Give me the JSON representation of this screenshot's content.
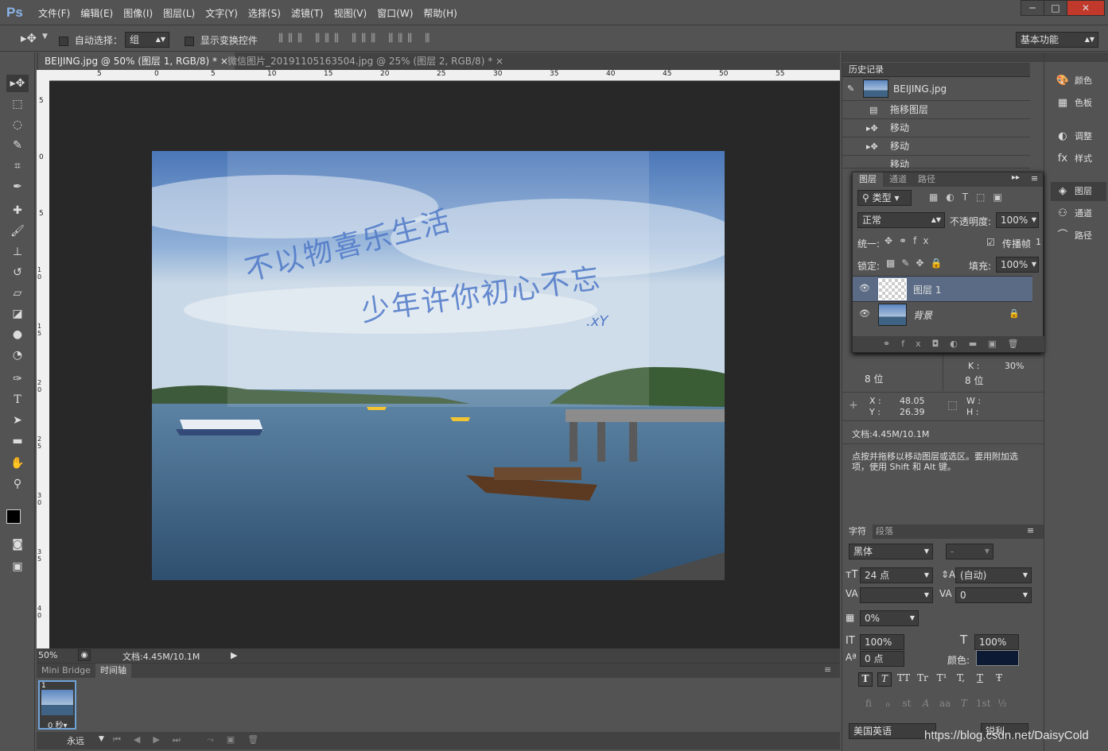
{
  "app": {
    "logo": "Ps"
  },
  "menu": [
    "文件(F)",
    "编辑(E)",
    "图像(I)",
    "图层(L)",
    "文字(Y)",
    "选择(S)",
    "滤镜(T)",
    "视图(V)",
    "窗口(W)",
    "帮助(H)"
  ],
  "window": {
    "minimize": "─",
    "restore": "□",
    "close": "✕"
  },
  "options": {
    "auto_select_label": "自动选择：",
    "auto_select_value": "组",
    "show_transform_label": "显示变换控件",
    "workspace": "基本功能"
  },
  "tabs": [
    {
      "label": "BEIJING.jpg @ 50% (图层 1, RGB/8) *",
      "close": "×"
    },
    {
      "label": "微信图片_20191105163504.jpg @ 25% (图层 2, RGB/8) *",
      "close": "×"
    }
  ],
  "ruler_top": [
    "5",
    "0",
    "5",
    "10",
    "15",
    "20",
    "25",
    "30",
    "35",
    "40",
    "45",
    "50",
    "55"
  ],
  "ruler_left": [
    "5",
    "0",
    "5",
    "10",
    "15",
    "20",
    "25",
    "30",
    "35",
    "40"
  ],
  "handwriting": {
    "line1": "不以物喜乐生活",
    "line2": "少年许你初心不忘",
    "sig": ".xY"
  },
  "status": {
    "zoom": "50%",
    "doc": "文档:4.45M/10.1M"
  },
  "bridge": {
    "tab1": "Mini Bridge",
    "tab2": "时间轴",
    "frame_number": "1",
    "frame_time": "0 秒▾",
    "loop": "永远"
  },
  "history": {
    "title": "历史记录",
    "snapshot": "BEIJING.jpg",
    "items": [
      "拖移图层",
      "移动",
      "移动",
      "移动"
    ]
  },
  "layers": {
    "tabs": [
      "图层",
      "通道",
      "路径"
    ],
    "filter": "类型",
    "blend": "正常",
    "opacity_label": "不透明度:",
    "opacity": "100%",
    "unify_label": "统一:",
    "propagate_label": "传播帧",
    "propagate_value": "1",
    "lock_label": "锁定:",
    "fill_label": "填充:",
    "fill": "100%",
    "list": [
      {
        "name": "图层 1",
        "selected": true
      },
      {
        "name": "背景",
        "italic": true,
        "locked": true
      }
    ]
  },
  "info": {
    "bit_left": "8 位",
    "k_label": "K :",
    "k_value": "30%",
    "bit_right": "8 位",
    "x_label": "X :",
    "x_value": "48.05",
    "y_label": "Y :",
    "y_value": "26.39",
    "w_label": "W :",
    "h_label": "H :",
    "doc": "文档:4.45M/10.1M",
    "hint": "点按并拖移以移动图层或选区。要用附加选项，使用 Shift 和 Alt 键。"
  },
  "character": {
    "tabs": [
      "字符",
      "段落"
    ],
    "font": "黑体",
    "style": "-",
    "size": "24 点",
    "leading": "(自动)",
    "kerning": "",
    "tracking": "0",
    "scale_tsume": "0%",
    "vscale": "100%",
    "hscale": "100%",
    "baseline": "0 点",
    "color_label": "颜色:",
    "color": "#0c1a33",
    "language": "美国英语",
    "aa": "锐利",
    "styles": [
      "T",
      "T",
      "TT",
      "Tr",
      "T¹",
      "T,",
      "T",
      "Ŧ"
    ],
    "opentype": [
      "fi",
      "ℴ",
      "st",
      "A",
      "aa",
      "T",
      "1st",
      "½"
    ]
  },
  "iconpanel": [
    "颜色",
    "色板",
    "调整",
    "样式",
    "图层",
    "通道",
    "路径"
  ],
  "watermark": "https://blog.csdn.net/DaisyCold"
}
